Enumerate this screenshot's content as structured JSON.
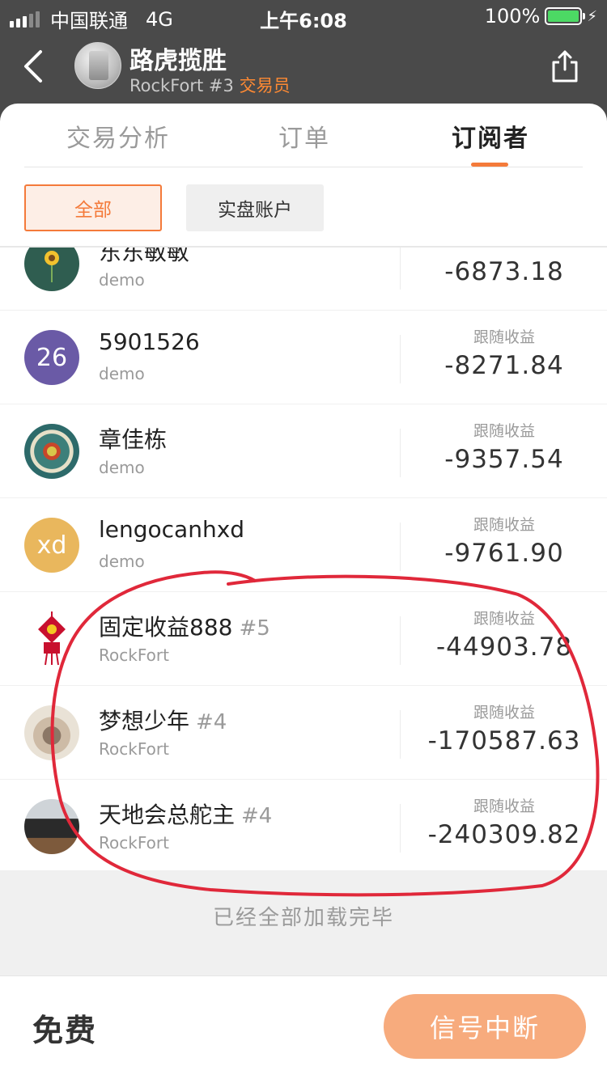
{
  "status_bar": {
    "carrier": "中国联通",
    "network": "4G",
    "time": "上午6:08",
    "battery": "100%"
  },
  "header": {
    "name": "路虎揽胜",
    "account": "RockFort #3",
    "role": "交易员"
  },
  "tabs": [
    {
      "label": "交易分析"
    },
    {
      "label": "订单"
    },
    {
      "label": "订阅者"
    }
  ],
  "filters": [
    {
      "label": "全部"
    },
    {
      "label": "实盘账户"
    }
  ],
  "subscribers": [
    {
      "name": "东东敏敏",
      "rank": "",
      "account": "demo",
      "earn_label": "",
      "earn_value": "-6873.18",
      "avatar_text": "",
      "avatar_color": "#2f5d50"
    },
    {
      "name": "5901526",
      "rank": "",
      "account": "demo",
      "earn_label": "跟随收益",
      "earn_value": "-8271.84",
      "avatar_text": "26",
      "avatar_color": "#6a5aa6"
    },
    {
      "name": "章佳栋",
      "rank": "",
      "account": "demo",
      "earn_label": "跟随收益",
      "earn_value": "-9357.54",
      "avatar_text": "",
      "avatar_color": "#2d6a6a"
    },
    {
      "name": "lengocanhxd",
      "rank": "",
      "account": "demo",
      "earn_label": "跟随收益",
      "earn_value": "-9761.90",
      "avatar_text": "xd",
      "avatar_color": "#e9b75d"
    },
    {
      "name": "固定收益888",
      "rank": "#5",
      "account": "RockFort",
      "earn_label": "跟随收益",
      "earn_value": "-44903.78",
      "avatar_text": "",
      "avatar_color": "#ffffff"
    },
    {
      "name": "梦想少年",
      "rank": "#4",
      "account": "RockFort",
      "earn_label": "跟随收益",
      "earn_value": "-170587.63",
      "avatar_text": "",
      "avatar_color": "#d9cbb7"
    },
    {
      "name": "天地会总舵主",
      "rank": "#4",
      "account": "RockFort",
      "earn_label": "跟随收益",
      "earn_value": "-240309.82",
      "avatar_text": "",
      "avatar_color": "#3a3a3a"
    }
  ],
  "footer": {
    "loaded_text": "已经全部加载完毕",
    "price": "免费",
    "signal_button": "信号中断"
  },
  "colors": {
    "accent": "#f47a3a",
    "header_bg": "#4a4a4a",
    "annotation": "#e0283a"
  }
}
